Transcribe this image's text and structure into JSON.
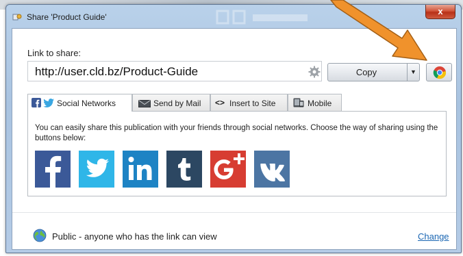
{
  "window": {
    "title": "Share 'Product Guide'",
    "close_label": "x"
  },
  "link": {
    "label": "Link to share:",
    "url": "http://user.cld.bz/Product-Guide",
    "copy_label": "Copy"
  },
  "tabs": [
    {
      "label": "Social Networks",
      "active": true
    },
    {
      "label": "Send by Mail",
      "active": false
    },
    {
      "label": "Insert to Site",
      "active": false
    },
    {
      "label": "Mobile",
      "active": false
    }
  ],
  "social_panel": {
    "description": "You can easily share this publication with your friends through social networks. Choose the way of sharing using the buttons below:",
    "networks": [
      {
        "icon": "facebook-icon",
        "color": "#3b5998"
      },
      {
        "icon": "twitter-icon",
        "color": "#2fb6e8"
      },
      {
        "icon": "linkedin-icon",
        "color": "#1d83c4"
      },
      {
        "icon": "tumblr-icon",
        "color": "#2c4762"
      },
      {
        "icon": "google-plus-icon",
        "color": "#d73d32"
      },
      {
        "icon": "vk-icon",
        "color": "#4c75a3"
      }
    ]
  },
  "footer": {
    "visibility_text": "Public - anyone who has the link can view",
    "change_label": "Change"
  },
  "colors": {
    "accent_orange": "#f0922c",
    "link_blue": "#1a66b3"
  }
}
